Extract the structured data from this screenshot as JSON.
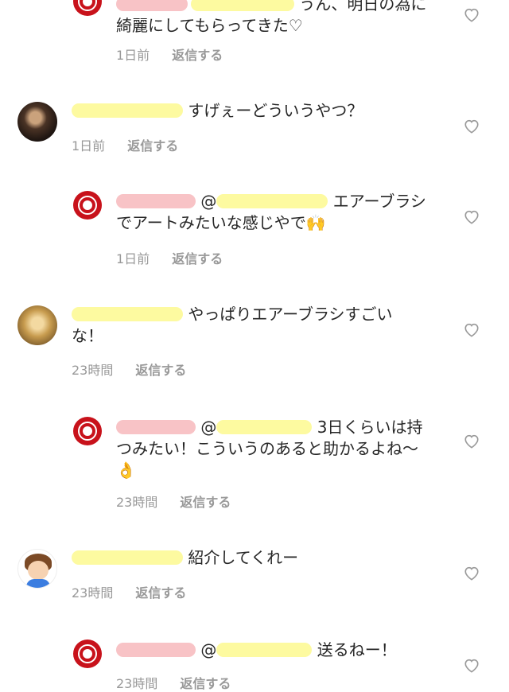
{
  "comments": [
    {
      "text": "うん、明日の為に綺麗にしてもらってきた♡",
      "time": "1日前",
      "reply_label": "返信する"
    },
    {
      "text": "すげぇーどういうやつ？",
      "time": "1日前",
      "reply_label": "返信する"
    },
    {
      "text": "エアーブラシでアートみたいな感じやで🙌",
      "time": "1日前",
      "reply_label": "返信する"
    },
    {
      "text": "やっぱりエアーブラシすごいな！",
      "time": "23時間",
      "reply_label": "返信する"
    },
    {
      "text": "3日くらいは持つみたい！こういうのあると助かるよね〜👌",
      "time": "23時間",
      "reply_label": "返信する"
    },
    {
      "text": "紹介してくれー",
      "time": "23時間",
      "reply_label": "返信する"
    },
    {
      "text": "送るねー！",
      "time": "23時間",
      "reply_label": "返信する"
    }
  ],
  "mention_prefix": "@",
  "icons": {
    "like": "heart-outline-icon",
    "avatar_reply": "red-circle-avatar"
  },
  "colors": {
    "meta_text": "#999999",
    "redact_yellow": "#fdfaa0",
    "redact_pink": "#f8c3c6",
    "reply_avatar": "#c8121b"
  }
}
